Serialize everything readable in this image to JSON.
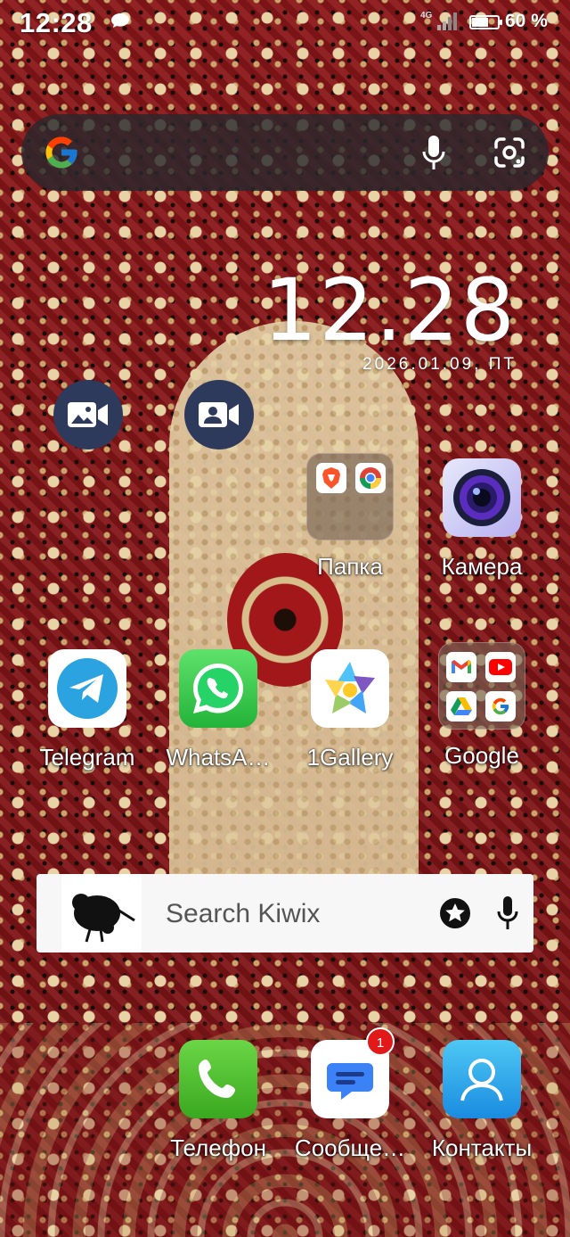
{
  "status_bar": {
    "time": "12:28",
    "network": "4G",
    "battery": "60 %"
  },
  "search_widget": {
    "brand": "Google"
  },
  "clock": {
    "time": "12.28",
    "date": "2026.01.09, ПТ"
  },
  "shortcuts": [
    {
      "name": "video-gallery-shortcut",
      "icon": "video-image-icon"
    },
    {
      "name": "video-contact-shortcut",
      "icon": "video-contact-icon"
    }
  ],
  "apps_row1": [
    {
      "label": "Папка",
      "icon": "folder-icon",
      "contents": [
        "brave-icon",
        "chrome-icon"
      ]
    },
    {
      "label": "Камера",
      "icon": "camera-icon"
    }
  ],
  "apps_row2": [
    {
      "label": "Telegram",
      "icon": "telegram-icon"
    },
    {
      "label": "WhatsA…",
      "icon": "whatsapp-icon"
    },
    {
      "label": "1Gallery",
      "icon": "gallery-icon"
    },
    {
      "label": "Google",
      "icon": "folder-icon",
      "contents": [
        "gmail-icon",
        "youtube-icon",
        "drive-icon",
        "google-icon"
      ]
    }
  ],
  "kiwix": {
    "placeholder": "Search Kiwix",
    "icons": [
      "kiwix-logo-icon",
      "star-icon",
      "mic-icon"
    ]
  },
  "dock": [
    {
      "label": "Телефон",
      "icon": "phone-icon"
    },
    {
      "label": "Сообще…",
      "icon": "messages-icon",
      "badge": "1"
    },
    {
      "label": "Контакты",
      "icon": "contacts-icon"
    }
  ],
  "colors": {
    "wallpaper_red": "#7c1416",
    "wallpaper_cream": "#e6d4aa",
    "badge": "#e11919",
    "search_bar": "#28282d"
  }
}
